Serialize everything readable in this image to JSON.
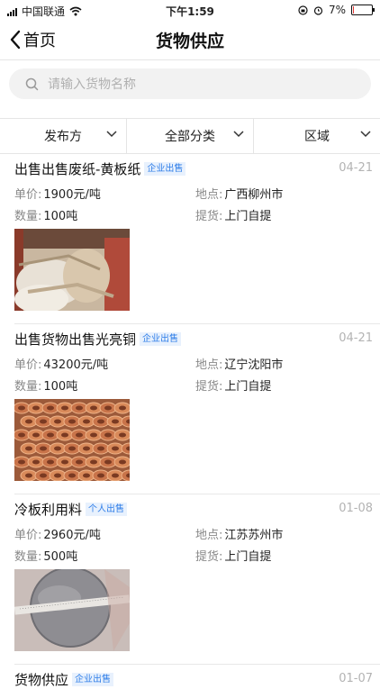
{
  "status_bar": {
    "carrier": "中国联通",
    "time": "下午1:59",
    "battery": "7%",
    "battery_level": 0.07
  },
  "nav": {
    "back_label": "首页",
    "title": "货物供应"
  },
  "search": {
    "placeholder": "请输入货物名称"
  },
  "filters": [
    {
      "label": "发布方"
    },
    {
      "label": "全部分类"
    },
    {
      "label": "区域"
    }
  ],
  "labels": {
    "price": "单价:",
    "location": "地点:",
    "quantity": "数量:",
    "pickup": "提货:"
  },
  "listings": [
    {
      "title": "出售出售废纸-黄板纸",
      "badge": "企业出售",
      "date": "04-21",
      "price": "1900元/吨",
      "location": "广西柳州市",
      "quantity": "100吨",
      "pickup": "上门自提",
      "image": "paper-bales-image"
    },
    {
      "title": "出售货物出售光亮铜",
      "badge": "企业出售",
      "date": "04-21",
      "price": "43200元/吨",
      "location": "辽宁沈阳市",
      "quantity": "100吨",
      "pickup": "上门自提",
      "image": "copper-coils-image"
    },
    {
      "title": "冷板利用料",
      "badge": "个人出售",
      "date": "01-08",
      "price": "2960元/吨",
      "location": "江苏苏州市",
      "quantity": "500吨",
      "pickup": "上门自提",
      "image": "steel-disc-image"
    },
    {
      "title": "货物供应",
      "badge": "企业出售",
      "date": "01-07"
    }
  ]
}
